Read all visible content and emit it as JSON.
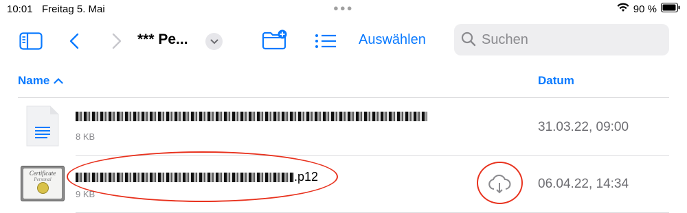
{
  "status": {
    "time": "10:01",
    "date": "Freitag 5. Mai",
    "battery": "90 %"
  },
  "toolbar": {
    "title": "*** Pe...",
    "select_label": "Auswählen",
    "search_placeholder": "Suchen"
  },
  "columns": {
    "name": "Name",
    "date": "Datum"
  },
  "files": [
    {
      "name_suffix": "",
      "size": "8 KB",
      "date": "31.03.22, 09:00",
      "icon": "document-icon"
    },
    {
      "name_suffix": ".p12",
      "size": "9 KB",
      "date": "06.04.22, 14:34",
      "icon": "certificate-icon",
      "cloud": true
    }
  ],
  "certificate_icon_text": {
    "line1": "Certificate",
    "line2": "Personal"
  },
  "colors": {
    "accent": "#0a7aff",
    "annotation": "#e8321e"
  }
}
